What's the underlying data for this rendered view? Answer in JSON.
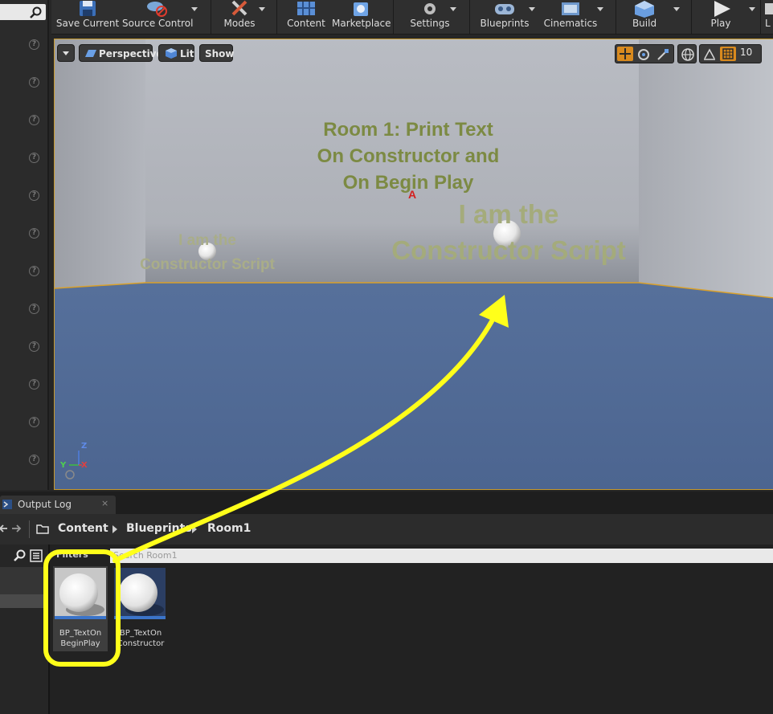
{
  "toolbar": {
    "buttons": [
      {
        "label": "Save Current",
        "icon": "save-icon"
      },
      {
        "label": "Source Control",
        "icon": "source-control-icon"
      },
      {
        "label": "Modes",
        "icon": "modes-icon"
      },
      {
        "label": "Content",
        "icon": "content-icon"
      },
      {
        "label": "Marketplace",
        "icon": "marketplace-icon"
      },
      {
        "label": "Settings",
        "icon": "settings-icon"
      },
      {
        "label": "Blueprints",
        "icon": "blueprints-icon"
      },
      {
        "label": "Cinematics",
        "icon": "cinematics-icon"
      },
      {
        "label": "Build",
        "icon": "build-icon"
      },
      {
        "label": "Play",
        "icon": "play-icon"
      },
      {
        "label": "L",
        "icon": "launch-icon"
      }
    ]
  },
  "viewport": {
    "perspective_label": "Perspective",
    "lit_label": "Lit",
    "show_label": "Show",
    "grid_snap_value": "10",
    "room_title": [
      "Room 1: Print Text",
      "On Constructor and",
      "On Begin Play"
    ],
    "text_small": [
      "I am the",
      "Constructor Script"
    ],
    "text_large": [
      "I am the",
      "Constructor Script"
    ],
    "axis_labels": {
      "z": "Z",
      "y": "Y",
      "x": "X"
    },
    "colors": {
      "room_text": "#7c8a43",
      "floor": "#4f6791",
      "selection": "#d9a02a"
    }
  },
  "output_log": {
    "tab_label": "Output Log"
  },
  "content_browser": {
    "breadcrumb": [
      "Content",
      "Blueprints",
      "Room1"
    ],
    "filters_label": "Filters",
    "search_placeholder": "Search Room1",
    "assets": [
      {
        "name_line1": "BP_TextOn",
        "name_line2": "BeginPlay"
      },
      {
        "name_line1": "BP_TextOn",
        "name_line2": "Constructor"
      }
    ]
  },
  "annotation": {
    "color": "#ffff1a"
  }
}
